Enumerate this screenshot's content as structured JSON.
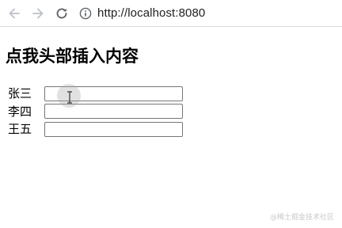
{
  "browser": {
    "url": "http://localhost:8080",
    "icons": {
      "back": "arrow-left-icon",
      "forward": "arrow-right-icon",
      "reload": "reload-icon",
      "info": "info-icon"
    }
  },
  "page": {
    "heading": "点我头部插入内容",
    "rows": [
      {
        "label": "张三",
        "value": ""
      },
      {
        "label": "李四",
        "value": ""
      },
      {
        "label": "王五",
        "value": ""
      }
    ]
  },
  "watermark": "@稀土掘金技术社区",
  "colors": {
    "toolbar_icon": "#5f6368",
    "toolbar_icon_disabled": "#bdc1c6",
    "watermark": "#c8c8c8"
  }
}
